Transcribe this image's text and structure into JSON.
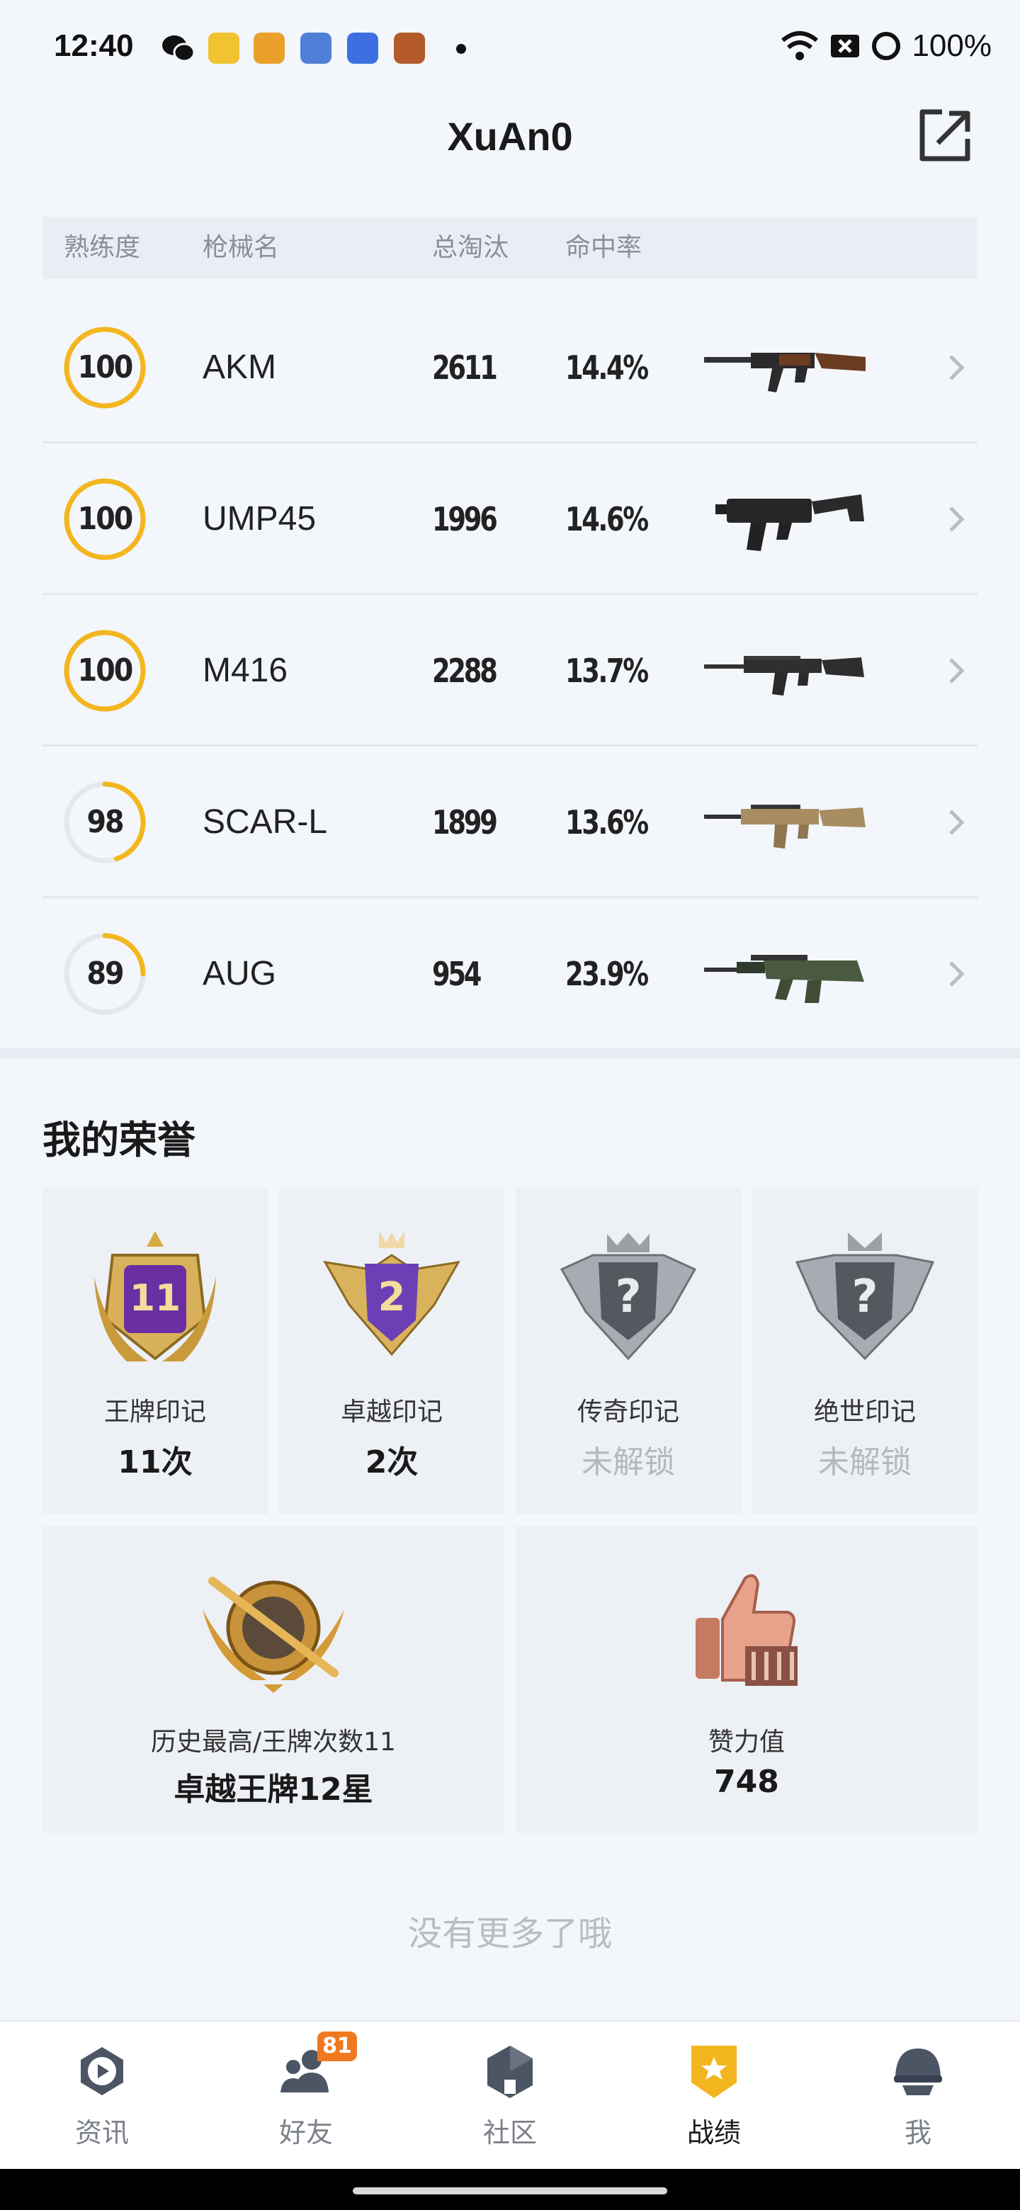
{
  "status_bar": {
    "time": "12:40",
    "battery": "100%",
    "icons": [
      "wechat-icon",
      "app-icon",
      "app-icon",
      "app-icon",
      "app-icon",
      "app-icon",
      "notification-dot",
      "wifi-icon",
      "signal-off-icon",
      "battery-ring-icon"
    ]
  },
  "header": {
    "title": "XuAn0",
    "share_icon": "share-external-icon"
  },
  "weapons": {
    "columns": [
      "熟练度",
      "枪械名",
      "总淘汰",
      "命中率"
    ],
    "rows": [
      {
        "mastery": "100",
        "mastery_fraction": 1.0,
        "name": "AKM",
        "kills": "2611",
        "hit_rate": "14.4%",
        "icon": "akm-rifle-icon"
      },
      {
        "mastery": "100",
        "mastery_fraction": 1.0,
        "name": "UMP45",
        "kills": "1996",
        "hit_rate": "14.6%",
        "icon": "ump45-smg-icon"
      },
      {
        "mastery": "100",
        "mastery_fraction": 1.0,
        "name": "M416",
        "kills": "2288",
        "hit_rate": "13.7%",
        "icon": "m416-rifle-icon"
      },
      {
        "mastery": "98",
        "mastery_fraction": 0.45,
        "name": "SCAR-L",
        "kills": "1899",
        "hit_rate": "13.6%",
        "icon": "scar-l-rifle-icon"
      },
      {
        "mastery": "89",
        "mastery_fraction": 0.25,
        "name": "AUG",
        "kills": "954",
        "hit_rate": "23.9%",
        "icon": "aug-rifle-icon"
      }
    ]
  },
  "honors": {
    "title": "我的荣誉",
    "marks": [
      {
        "label": "王牌印记",
        "value": "11次",
        "badge_text": "11",
        "locked": false
      },
      {
        "label": "卓越印记",
        "value": "2次",
        "badge_text": "2",
        "locked": false
      },
      {
        "label": "传奇印记",
        "value": "未解锁",
        "badge_text": "?",
        "locked": true
      },
      {
        "label": "绝世印记",
        "value": "未解锁",
        "badge_text": "?",
        "locked": true
      }
    ],
    "highest": {
      "label": "历史最高/王牌次数11",
      "value": "卓越王牌12星"
    },
    "likes": {
      "label": "赞力值",
      "value": "748"
    }
  },
  "no_more": "没有更多了哦",
  "tabbar": {
    "tabs": [
      {
        "label": "资讯",
        "icon": "news-play-icon"
      },
      {
        "label": "好友",
        "icon": "friends-icon"
      },
      {
        "label": "社区",
        "icon": "community-icon"
      },
      {
        "label": "战绩",
        "icon": "record-shield-icon"
      },
      {
        "label": "我",
        "icon": "profile-helmet-icon"
      }
    ],
    "friend_badge": "81",
    "active": "战绩",
    "colors": {
      "accent": "#f3b61f",
      "badge": "#f0791f"
    }
  }
}
